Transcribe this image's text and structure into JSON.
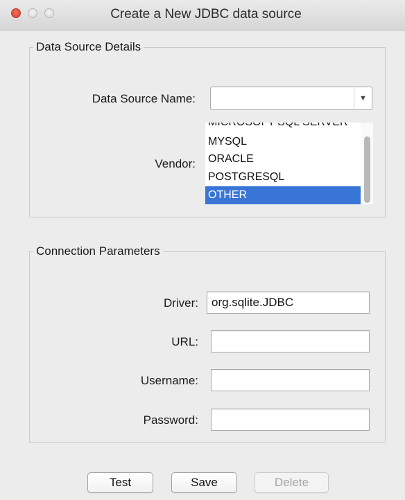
{
  "window": {
    "title": "Create a New JDBC data source"
  },
  "details": {
    "legend": "Data Source Details",
    "name_label": "Data Source Name:",
    "name_value": "",
    "vendor_label": "Vendor:",
    "vendors": [
      "MICROSOFT SQL SERVER",
      "MYSQL",
      "ORACLE",
      "POSTGRESQL",
      "OTHER"
    ],
    "selected_vendor": "OTHER"
  },
  "connection": {
    "legend": "Connection Parameters",
    "driver_label": "Driver:",
    "driver_value": "org.sqlite.JDBC",
    "url_label": "URL:",
    "url_value": "",
    "username_label": "Username:",
    "username_value": "",
    "password_label": "Password:",
    "password_value": ""
  },
  "buttons": {
    "test": "Test",
    "save": "Save",
    "delete": "Delete"
  },
  "colors": {
    "selection": "#3875d7",
    "close_button": "#e0483a"
  }
}
